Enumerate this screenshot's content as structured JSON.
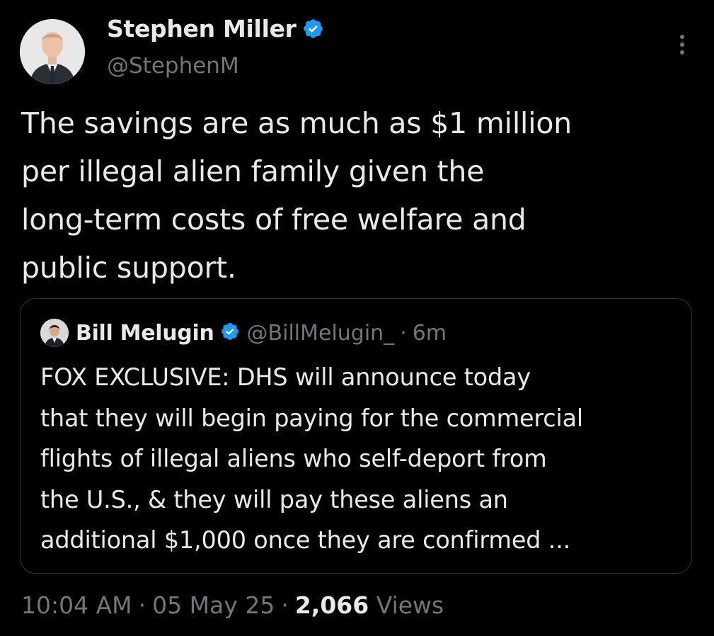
{
  "author": {
    "name": "Stephen Miller",
    "handle": "@StephenM",
    "verified_icon": "verified-badge-icon"
  },
  "tweet": {
    "text_lines": [
      "The savings are as much as $1 million",
      "per illegal alien family given the",
      "long-term costs of free welfare and",
      "public support."
    ]
  },
  "quote": {
    "name": "Bill Melugin",
    "handle": "@BillMelugin_",
    "dot": "·",
    "time": "6m",
    "text_lines": [
      "FOX EXCLUSIVE: DHS will announce today",
      "that they will begin paying for the commercial",
      "flights of illegal aliens who self-deport from",
      "the U.S., & they will pay these aliens an",
      "additional $1,000 once they are confirmed ..."
    ]
  },
  "meta": {
    "time": "10:04 AM",
    "date": "05 May 25",
    "separator": "·",
    "views_count": "2,066",
    "views_label": "Views"
  },
  "colors": {
    "background": "#000000",
    "text": "#e7e9ea",
    "muted": "#71767b",
    "verified": "#1d9bf0",
    "border": "#2f3336"
  }
}
